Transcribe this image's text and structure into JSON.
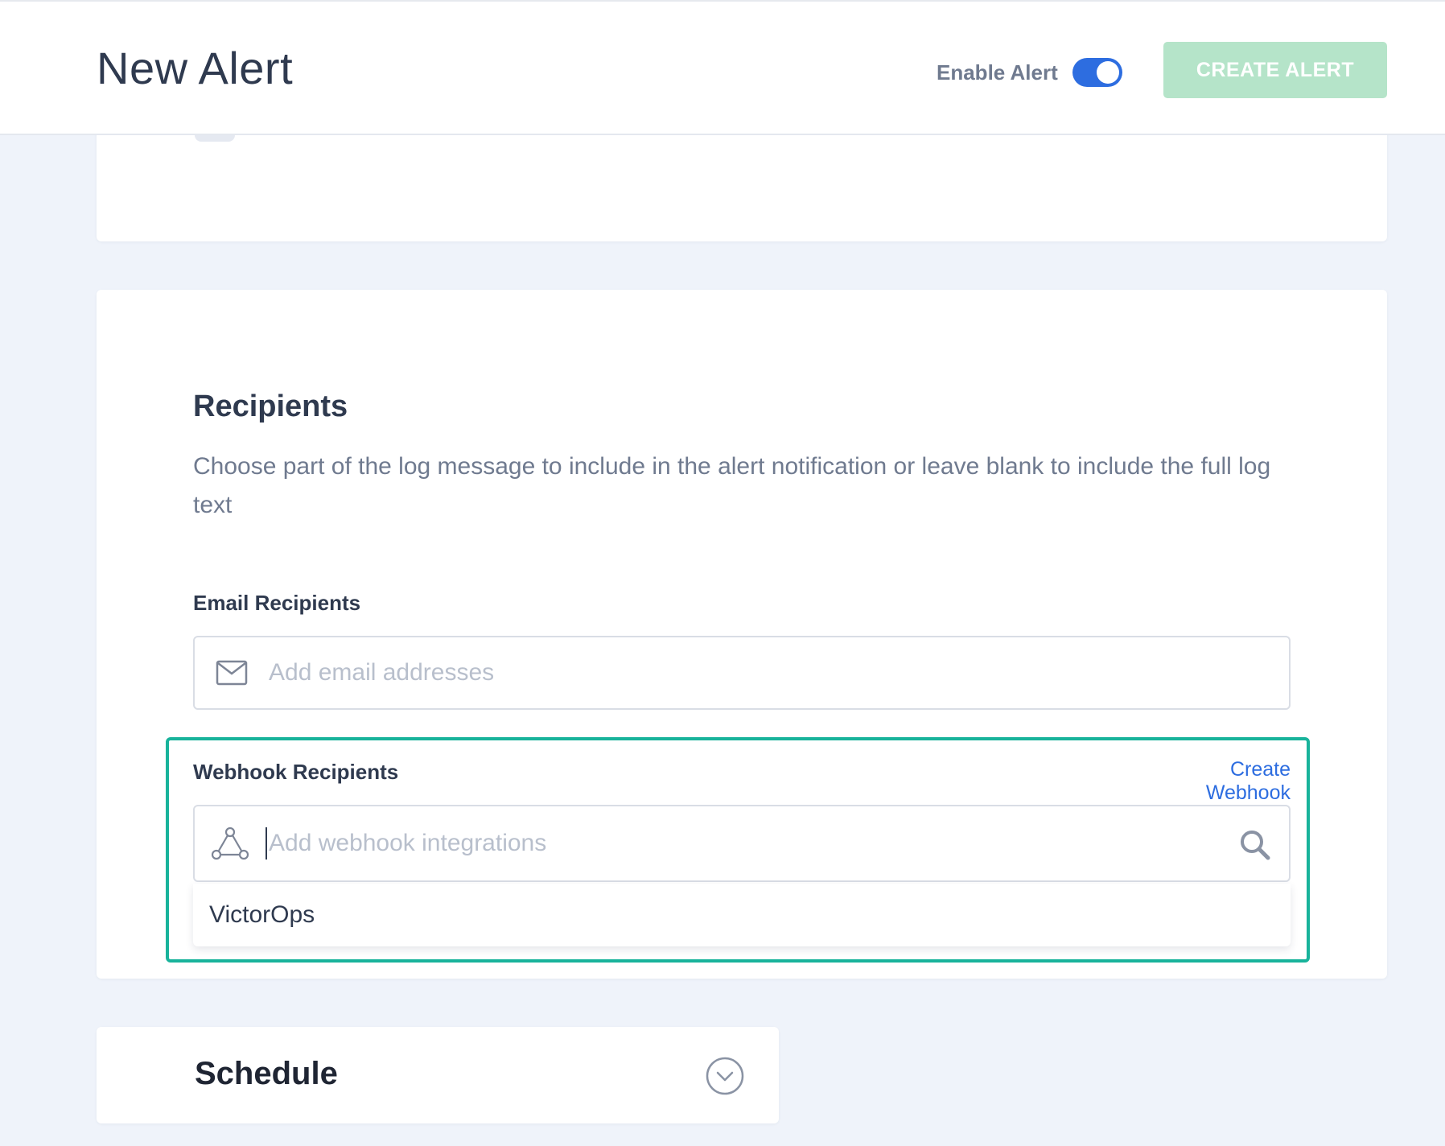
{
  "header": {
    "title": "New Alert",
    "enable_label": "Enable Alert",
    "enable_on": true,
    "create_button": "CREATE ALERT"
  },
  "recipients": {
    "title": "Recipients",
    "description": "Choose part of the log message to include in the alert notification or leave blank to include the full log text",
    "email": {
      "label": "Email Recipients",
      "placeholder": "Add email addresses",
      "icon": "mail-icon"
    },
    "webhook": {
      "label": "Webhook Recipients",
      "create_link": "Create Webhook",
      "placeholder": "Add webhook integrations",
      "icon": "webhook-icon",
      "search_icon": "search-icon",
      "options": [
        "VictorOps"
      ]
    }
  },
  "schedule": {
    "title": "Schedule",
    "icon": "chevron-down-circle-icon"
  },
  "colors": {
    "accent": "#2d6de0",
    "create_button_bg": "#b5e4c9",
    "highlight": "#18b39b",
    "page_bg": "#eff3fa"
  }
}
